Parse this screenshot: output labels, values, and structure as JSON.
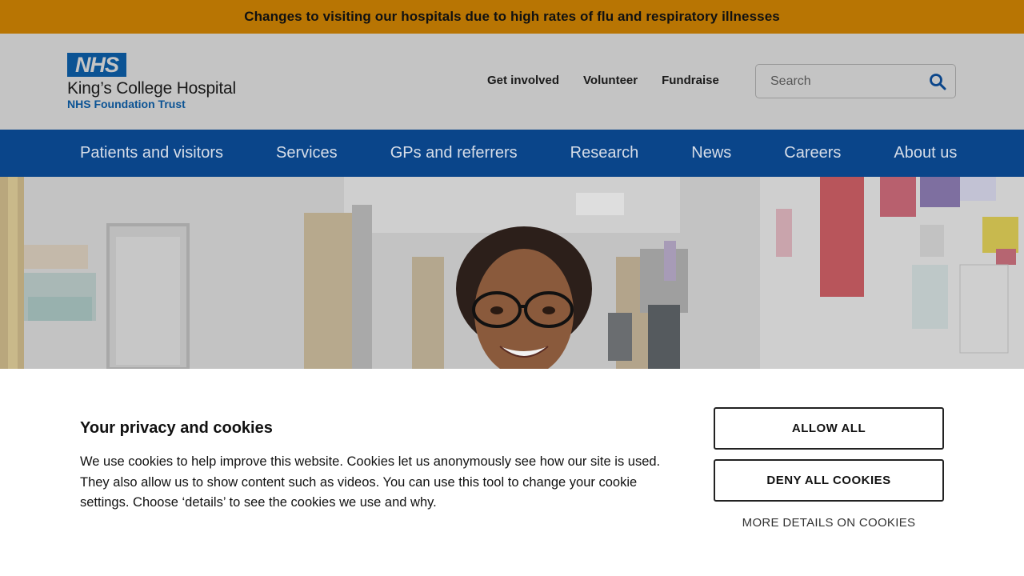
{
  "alert": {
    "text": "Changes to visiting our hospitals due to high rates of flu and respiratory illnesses"
  },
  "header": {
    "logo": {
      "nhs": "NHS",
      "name": "King’s College Hospital",
      "subtitle": "NHS Foundation Trust"
    },
    "utility_links": [
      "Get involved",
      "Volunteer",
      "Fundraise"
    ],
    "search": {
      "placeholder": "Search",
      "value": ""
    }
  },
  "nav": {
    "items": [
      "Patients and visitors",
      "Services",
      "GPs and referrers",
      "Research",
      "News",
      "Careers",
      "About us"
    ]
  },
  "cookies": {
    "title": "Your privacy and cookies",
    "text": "We use cookies to help improve this website. Cookies let us anonymously see how our site is used. They also allow us to show content such as videos. You can use this tool to change your cookie settings. Choose ‘details’ to see the cookies we use and why.",
    "allow_label": "ALLOW ALL",
    "deny_label": "DENY ALL COOKIES",
    "details_label": "MORE DETAILS ON COOKIES"
  },
  "colors": {
    "banner": "#b87503",
    "nav": "#0a458a",
    "nhs_blue": "#0b5394",
    "header_bg": "#c4c4c4"
  },
  "icons": {
    "search": "search-icon"
  }
}
